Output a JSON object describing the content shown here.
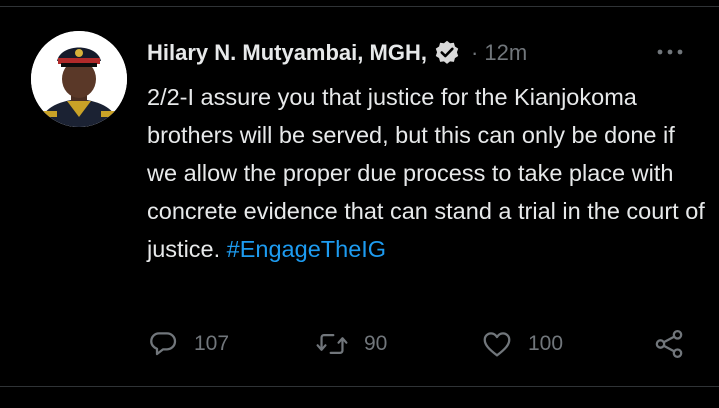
{
  "tweet": {
    "author": {
      "display_name": "Hilary N. Mutyambai, MGH,",
      "verified_icon": "verified-badge-icon",
      "avatar_icon": "profile-photo-uniformed-officer"
    },
    "meta": "· 12m",
    "more_icon": "more-options-icon",
    "text_main": "2/2-I assure you that justice for the Kianjokoma brothers will be served, but this can only be done if we allow the proper due process to take place with concrete evidence that can stand a trial in the court of justice.",
    "hashtag": "#EngageTheIG",
    "actions": {
      "reply_count": "107",
      "retweet_count": "90",
      "like_count": "100",
      "share_icon": "share-icon"
    }
  },
  "colors": {
    "background": "#000000",
    "text": "#e7e9ea",
    "muted": "#71767b",
    "accent": "#1d9bf0",
    "divider": "#2f3336"
  }
}
